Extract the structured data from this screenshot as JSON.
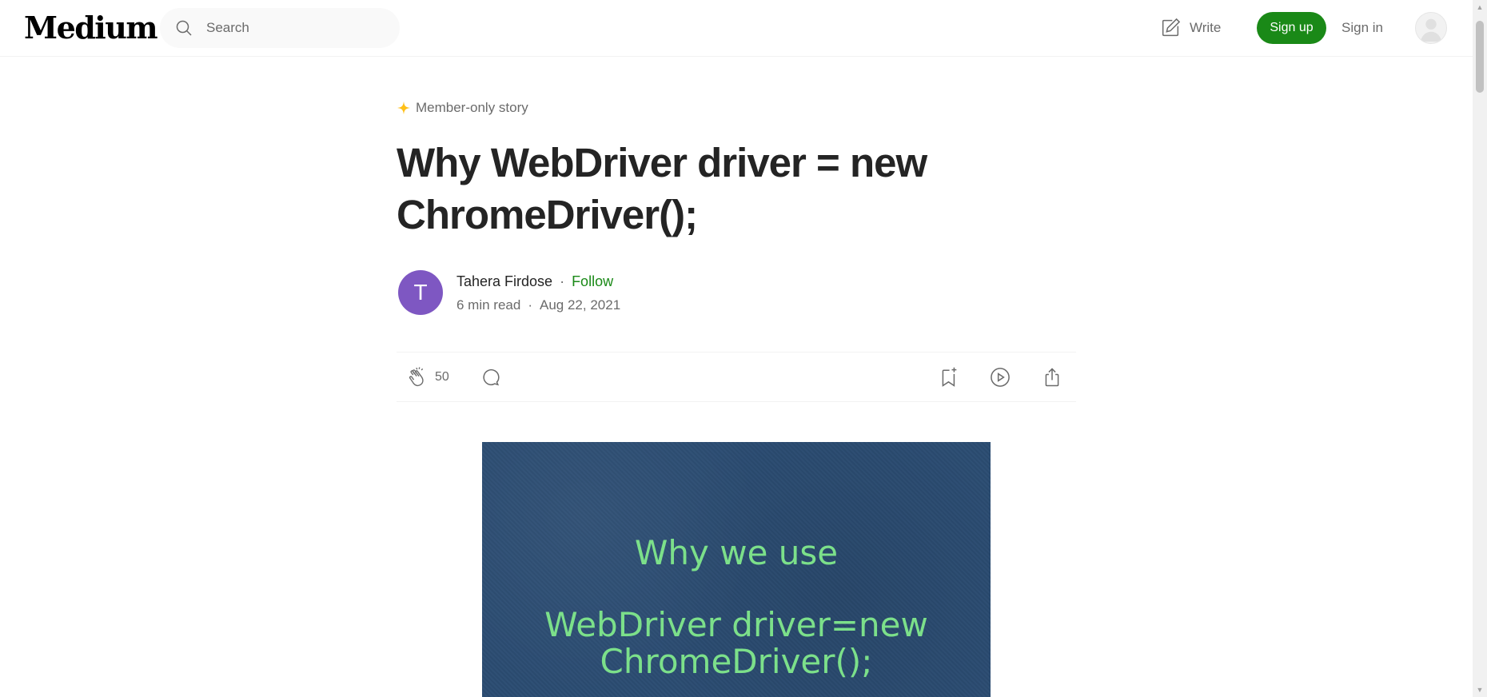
{
  "header": {
    "logo": "Medium",
    "search_placeholder": "Search",
    "write_label": "Write",
    "signup_label": "Sign up",
    "signin_label": "Sign in"
  },
  "article": {
    "member_label": "Member-only story",
    "title": "Why WebDriver driver = new ChromeDriver();",
    "author": {
      "initial": "T",
      "name": "Tahera Firdose",
      "follow_label": "Follow",
      "separator": "·"
    },
    "read_time": "6 min read",
    "date": "Aug 22, 2021",
    "clap_count": "50",
    "hero_image": {
      "line1": "Why we use",
      "line2": "WebDriver driver=new",
      "line3": "ChromeDriver();"
    }
  },
  "icons": {
    "search": "search-icon",
    "write": "write-icon",
    "star": "star-icon",
    "clap": "clap-icon",
    "comment": "comment-icon",
    "bookmark": "bookmark-add-icon",
    "listen": "play-icon",
    "share": "share-icon"
  },
  "colors": {
    "brand_green": "#1a8917",
    "member_star": "#ffc017",
    "author_avatar": "#7e57c2",
    "hero_bg": "#2b4c72",
    "hero_text": "#7ce08a"
  }
}
